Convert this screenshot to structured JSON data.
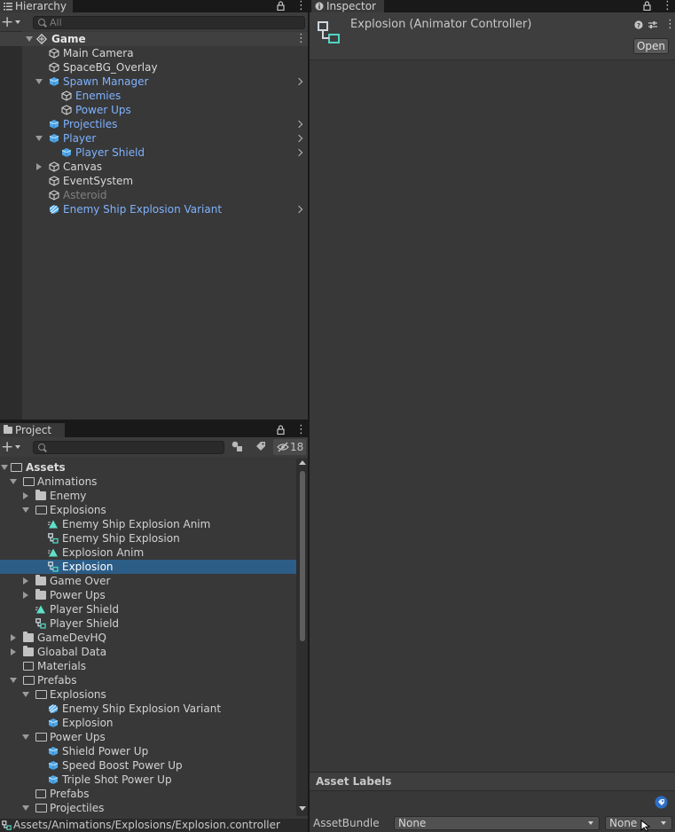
{
  "hierarchy": {
    "tab_label": "Hierarchy",
    "search_placeholder": "All",
    "scene_name": "Game",
    "items": [
      {
        "label": "Main Camera",
        "style": "white",
        "icon": "cube-outline-icon",
        "depth": 1,
        "expand": "none"
      },
      {
        "label": "SpaceBG_Overlay",
        "style": "white",
        "icon": "cube-outline-icon",
        "depth": 1,
        "expand": "none"
      },
      {
        "label": "Spawn Manager",
        "style": "blue",
        "icon": "prefab-cube-icon",
        "depth": 1,
        "expand": "open",
        "chevron": true
      },
      {
        "label": "Enemies",
        "style": "blue",
        "icon": "cube-outline-icon",
        "depth": 2,
        "expand": "none"
      },
      {
        "label": "Power Ups",
        "style": "blue",
        "icon": "cube-outline-icon",
        "depth": 2,
        "expand": "none"
      },
      {
        "label": "Projectiles",
        "style": "blue",
        "icon": "prefab-cube-icon",
        "depth": 1,
        "expand": "none",
        "chevron": true
      },
      {
        "label": "Player",
        "style": "blue",
        "icon": "prefab-cube-icon",
        "depth": 1,
        "expand": "open",
        "chevron": true
      },
      {
        "label": "Player Shield",
        "style": "blue",
        "icon": "prefab-cube-icon",
        "depth": 2,
        "expand": "none",
        "chevron": true
      },
      {
        "label": "Canvas",
        "style": "white",
        "icon": "cube-outline-icon",
        "depth": 1,
        "expand": "closed"
      },
      {
        "label": "EventSystem",
        "style": "white",
        "icon": "cube-outline-icon",
        "depth": 1,
        "expand": "none"
      },
      {
        "label": "Asteroid",
        "style": "dim",
        "icon": "cube-outline-icon",
        "depth": 1,
        "expand": "none"
      },
      {
        "label": "Enemy Ship Explosion Variant",
        "style": "blue",
        "icon": "prefab-variant-icon",
        "depth": 1,
        "expand": "none",
        "chevron": true
      }
    ]
  },
  "inspector": {
    "tab_label": "Inspector",
    "object_title": "Explosion (Animator Controller)",
    "open_button": "Open",
    "asset_labels_title": "Asset Labels",
    "assetbundle_label": "AssetBundle",
    "assetbundle_value": "None",
    "variant_value": "None"
  },
  "project": {
    "tab_label": "Project",
    "hidden_count": "18",
    "root": "Assets",
    "items": [
      {
        "label": "Animations",
        "icon": "folder-open-icon",
        "depth": 1,
        "expand": "open"
      },
      {
        "label": "Enemy",
        "icon": "folder-icon",
        "depth": 2,
        "expand": "closed"
      },
      {
        "label": "Explosions",
        "icon": "folder-open-icon",
        "depth": 2,
        "expand": "open"
      },
      {
        "label": "Enemy Ship Explosion Anim",
        "icon": "animation-clip-icon",
        "depth": 3,
        "expand": "none"
      },
      {
        "label": "Enemy Ship Explosion",
        "icon": "animator-controller-icon",
        "depth": 3,
        "expand": "none"
      },
      {
        "label": "Explosion Anim",
        "icon": "animation-clip-icon",
        "depth": 3,
        "expand": "none"
      },
      {
        "label": "Explosion",
        "icon": "animator-controller-icon",
        "depth": 3,
        "expand": "none",
        "selected": true
      },
      {
        "label": "Game Over",
        "icon": "folder-icon",
        "depth": 2,
        "expand": "closed"
      },
      {
        "label": "Power Ups",
        "icon": "folder-icon",
        "depth": 2,
        "expand": "closed"
      },
      {
        "label": "Player Shield",
        "icon": "animation-clip-icon",
        "depth": 2,
        "expand": "none"
      },
      {
        "label": "Player Shield",
        "icon": "animator-controller-icon",
        "depth": 2,
        "expand": "none"
      },
      {
        "label": "GameDevHQ",
        "icon": "folder-icon",
        "depth": 1,
        "expand": "closed"
      },
      {
        "label": "Gloabal Data",
        "icon": "folder-icon",
        "depth": 1,
        "expand": "closed"
      },
      {
        "label": "Materials",
        "icon": "folder-empty-icon",
        "depth": 1,
        "expand": "none"
      },
      {
        "label": "Prefabs",
        "icon": "folder-open-icon",
        "depth": 1,
        "expand": "open"
      },
      {
        "label": "Explosions",
        "icon": "folder-open-icon",
        "depth": 2,
        "expand": "open"
      },
      {
        "label": "Enemy Ship Explosion Variant",
        "icon": "prefab-variant-icon",
        "depth": 3,
        "expand": "none"
      },
      {
        "label": "Explosion",
        "icon": "prefab-cube-icon",
        "depth": 3,
        "expand": "none"
      },
      {
        "label": "Power Ups",
        "icon": "folder-open-icon",
        "depth": 2,
        "expand": "open"
      },
      {
        "label": "Shield Power Up",
        "icon": "prefab-cube-icon",
        "depth": 3,
        "expand": "none"
      },
      {
        "label": "Speed Boost Power Up",
        "icon": "prefab-cube-icon",
        "depth": 3,
        "expand": "none"
      },
      {
        "label": "Triple Shot Power Up",
        "icon": "prefab-cube-icon",
        "depth": 3,
        "expand": "none"
      },
      {
        "label": "Prefabs",
        "icon": "folder-empty-icon",
        "depth": 2,
        "expand": "none"
      },
      {
        "label": "Projectiles",
        "icon": "folder-open-icon",
        "depth": 2,
        "expand": "open"
      }
    ],
    "status_path": "Assets/Animations/Explosions/Explosion.controller"
  },
  "colors": {
    "panel": "#383838",
    "selection": "#2c5d87",
    "prefab_blue": "#7fb2ff",
    "clip_teal": "#5ee0c6"
  }
}
